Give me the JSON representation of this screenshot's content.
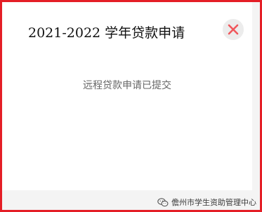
{
  "dialog": {
    "title": "2021-2022 学年贷款申请",
    "message": "远程贷款申请已提交",
    "close_icon": "close-x-icon"
  },
  "watermark": {
    "text": "儋州市学生资助管理中心",
    "icon": "wechat-icon"
  },
  "colors": {
    "frame_border": "#e41e26",
    "close_x": "#f0575c",
    "close_bg": "#ececec",
    "message_text": "#666666"
  }
}
